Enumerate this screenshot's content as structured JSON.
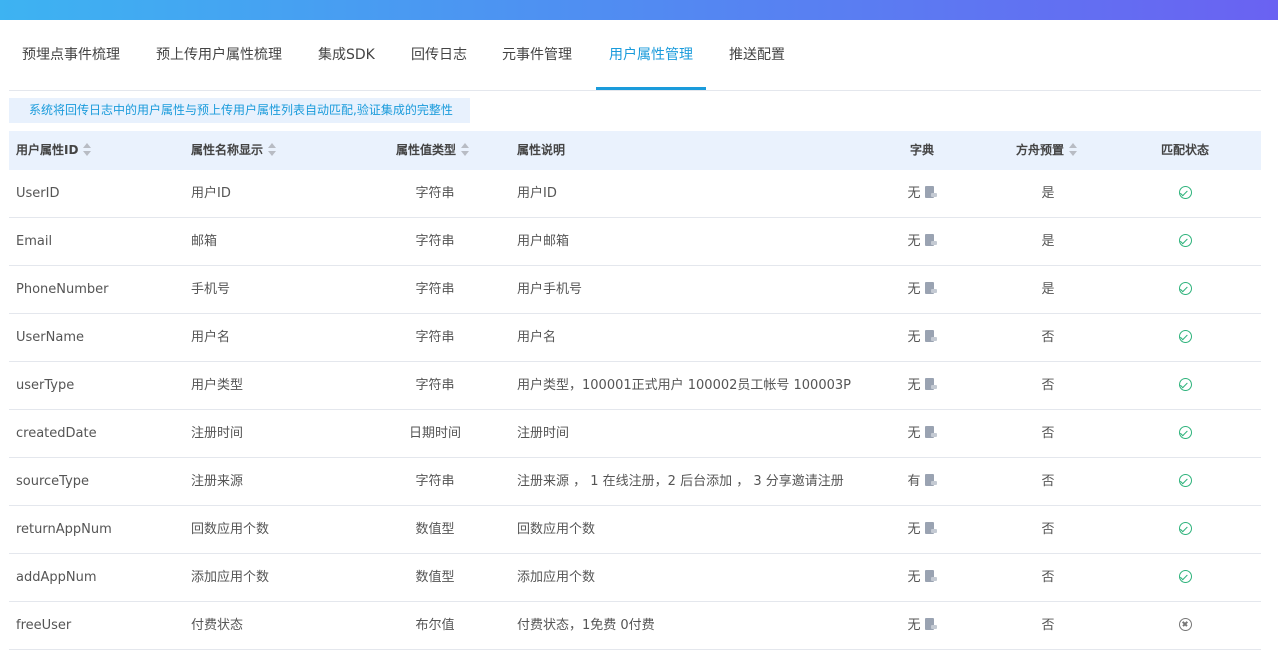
{
  "tabs": [
    {
      "label": "预埋点事件梳理"
    },
    {
      "label": "预上传用户属性梳理"
    },
    {
      "label": "集成SDK"
    },
    {
      "label": "回传日志"
    },
    {
      "label": "元事件管理"
    },
    {
      "label": "用户属性管理",
      "active": true
    },
    {
      "label": "推送配置"
    }
  ],
  "notice": "系统将回传日志中的用户属性与预上传用户属性列表自动匹配,验证集成的完整性",
  "table": {
    "headers": {
      "id": "用户属性ID",
      "name": "属性名称显示",
      "type": "属性值类型",
      "desc": "属性说明",
      "dict": "字典",
      "preset": "方舟预置",
      "status": "匹配状态"
    },
    "rows": [
      {
        "id": "UserID",
        "name": "用户ID",
        "type": "字符串",
        "desc": "用户ID",
        "dict": "无",
        "preset": "是",
        "status": "matched"
      },
      {
        "id": "Email",
        "name": "邮箱",
        "type": "字符串",
        "desc": "用户邮箱",
        "dict": "无",
        "preset": "是",
        "status": "matched"
      },
      {
        "id": "PhoneNumber",
        "name": "手机号",
        "type": "字符串",
        "desc": "用户手机号",
        "dict": "无",
        "preset": "是",
        "status": "matched"
      },
      {
        "id": "UserName",
        "name": "用户名",
        "type": "字符串",
        "desc": "用户名",
        "dict": "无",
        "preset": "否",
        "status": "matched"
      },
      {
        "id": "userType",
        "name": "用户类型",
        "type": "字符串",
        "desc": "用户类型，100001正式用户 100002员工帐号 100003P",
        "dict": "无",
        "preset": "否",
        "status": "matched"
      },
      {
        "id": "createdDate",
        "name": "注册时间",
        "type": "日期时间",
        "desc": "注册时间",
        "dict": "无",
        "preset": "否",
        "status": "matched"
      },
      {
        "id": "sourceType",
        "name": "注册来源",
        "type": "字符串",
        "desc": "注册来源 ， 1 在线注册，2 后台添加 ， 3 分享邀请注册",
        "dict": "有",
        "preset": "否",
        "status": "matched"
      },
      {
        "id": "returnAppNum",
        "name": "回数应用个数",
        "type": "数值型",
        "desc": "回数应用个数",
        "dict": "无",
        "preset": "否",
        "status": "matched"
      },
      {
        "id": "addAppNum",
        "name": "添加应用个数",
        "type": "数值型",
        "desc": "添加应用个数",
        "dict": "无",
        "preset": "否",
        "status": "matched"
      },
      {
        "id": "freeUser",
        "name": "付费状态",
        "type": "布尔值",
        "desc": "付费状态，1免费 0付费",
        "dict": "无",
        "preset": "否",
        "status": "unmatched"
      }
    ]
  },
  "colors": {
    "accent": "#1a9bdb",
    "matched": "#2fb37c",
    "unmatched": "#777777"
  }
}
